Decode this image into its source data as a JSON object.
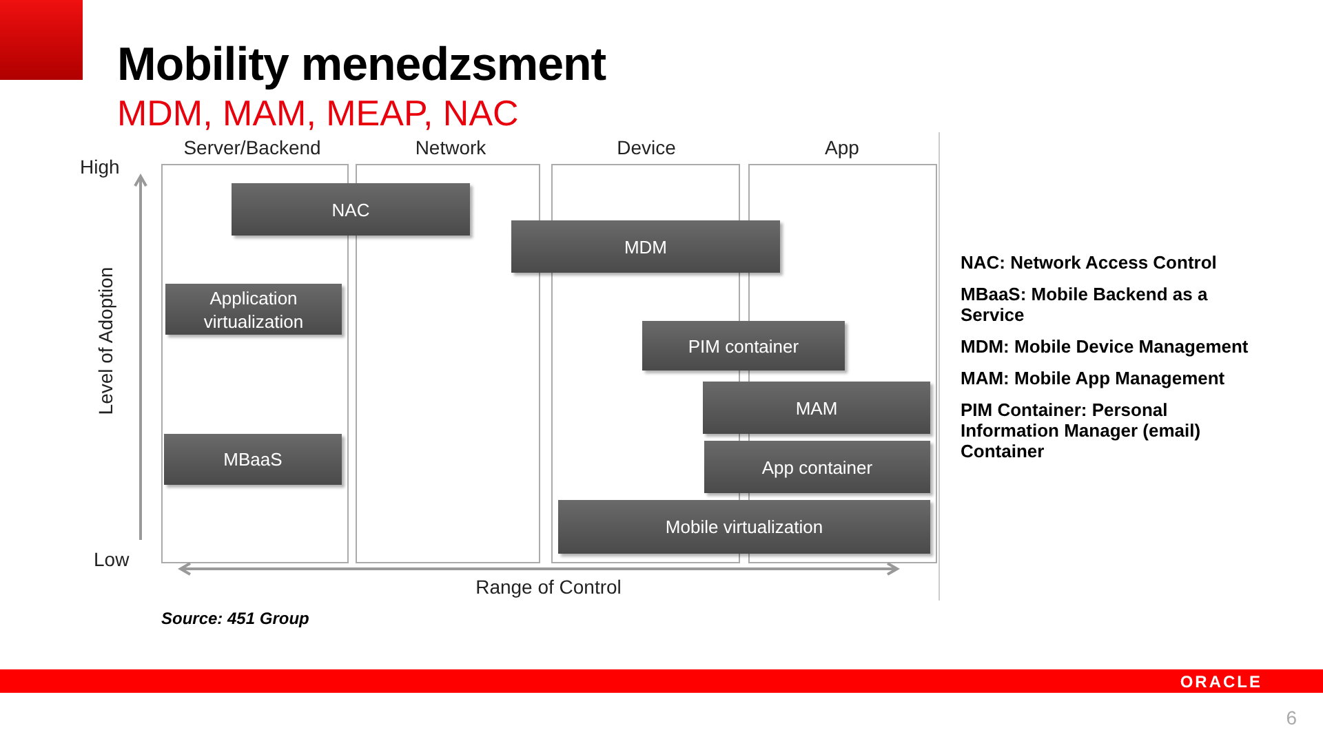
{
  "title": "Mobility menedzsment",
  "subtitle": "MDM, MAM, MEAP, NAC",
  "diagram": {
    "column_headers": [
      "Server/Backend",
      "Network",
      "Device",
      "App"
    ],
    "y_axis": {
      "high": "High",
      "low": "Low",
      "label": "Level of Adoption"
    },
    "x_axis": {
      "label": "Range of Control"
    },
    "boxes": [
      {
        "label": "NAC"
      },
      {
        "label": "MDM"
      },
      {
        "label": "Application virtualization"
      },
      {
        "label": "PIM container"
      },
      {
        "label": "MAM"
      },
      {
        "label": "App container"
      },
      {
        "label": "MBaaS"
      },
      {
        "label": "Mobile virtualization"
      }
    ]
  },
  "legend": [
    "NAC: Network Access Control",
    "MBaaS: Mobile Backend as a Service",
    "MDM: Mobile Device Management",
    "MAM: Mobile App Management",
    "PIM Container: Personal Information Manager (email) Container"
  ],
  "source": "Source: 451 Group",
  "footer": {
    "logo": "ORACLE",
    "page_number": "6"
  }
}
